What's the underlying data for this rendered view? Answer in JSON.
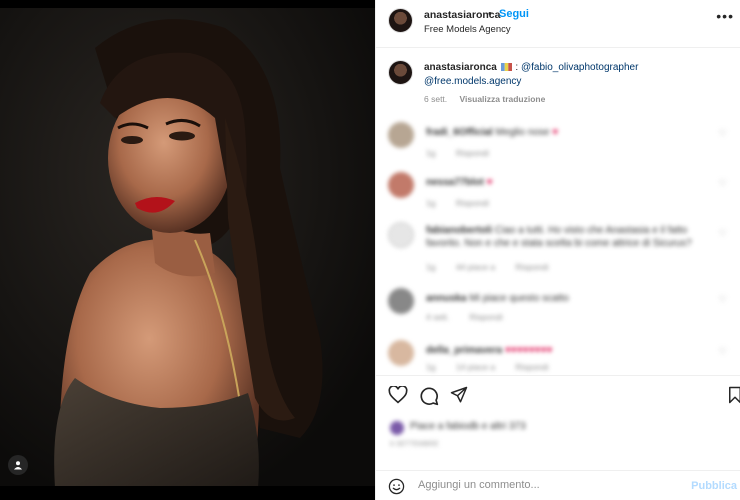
{
  "post": {
    "username": "anastasiaronca",
    "separator": "•",
    "follow_label": "Segui",
    "location": "Free Models Agency",
    "more_label": "•••"
  },
  "caption": {
    "username": "anastasiaronca",
    "flag_icon": "flag-icon",
    "separator": ":",
    "photographer": "@fabio_olivaphotographer",
    "agency": "@free.models.agency",
    "time": "6 sett.",
    "translate_label": "Visualizza traduzione"
  },
  "comments": [
    {
      "user": "fradi_6Official",
      "text": "Meglio nose",
      "emoji": "♥",
      "time": "1g",
      "reply": "Rispondi"
    },
    {
      "user": "nessa77blot",
      "text": "",
      "emoji": "♥",
      "time": "1g",
      "reply": "Rispondi"
    },
    {
      "user": "fabianobertoli",
      "text": "Ciao a tutti. Ho visto che Anastasia e il fatto favorito. Non e che e stata scelta bi come attrice di Sicurus?",
      "emoji": "",
      "time": "1g",
      "likes": "44 piace a",
      "reply": "Rispondi"
    },
    {
      "user": "annuska",
      "text": "Mi piace questo scatto",
      "emoji": "",
      "time": "4 sett.",
      "reply": "Rispondi"
    },
    {
      "user": "della_primavera",
      "text": "",
      "emoji": "♥♥♥♥♥♥♥♥",
      "time": "1g",
      "likes": "14 piace a",
      "reply": "Rispondi"
    }
  ],
  "likes": {
    "text": "Piace a fabiodb e altri 373",
    "date": "6 SETTEMBRE"
  },
  "add_comment": {
    "placeholder": "Aggiungi un commento...",
    "publish_label": "Pubblica"
  },
  "icons": {
    "like": "heart-icon",
    "comment": "comment-icon",
    "share": "send-icon",
    "save": "bookmark-icon",
    "emoji": "smiley-icon",
    "tag": "user-tag-icon"
  },
  "colors": {
    "accent": "#0095f6",
    "link": "#00376b",
    "muted": "#8e8e8e",
    "publish_disabled": "#b3dbff"
  }
}
